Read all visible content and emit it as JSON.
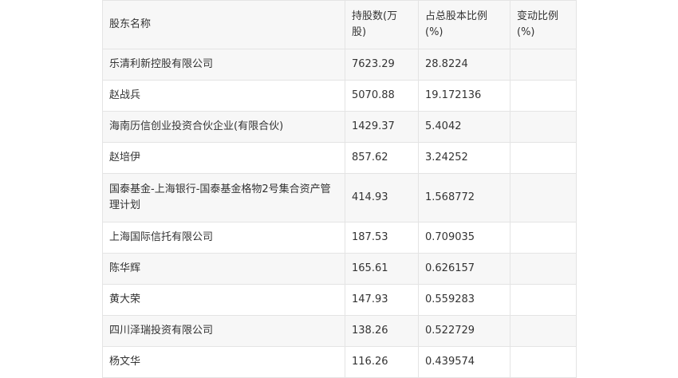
{
  "table": {
    "headers": [
      "股东名称",
      "持股数(万股)",
      "占总股本比例(%)",
      "变动比例(%)"
    ],
    "rows": [
      [
        "乐清利新控股有限公司",
        "7623.29",
        "28.8224",
        ""
      ],
      [
        "赵战兵",
        "5070.88",
        "19.172136",
        ""
      ],
      [
        "海南历信创业投资合伙企业(有限合伙)",
        "1429.37",
        "5.4042",
        ""
      ],
      [
        "赵培伊",
        "857.62",
        "3.24252",
        ""
      ],
      [
        "国泰基金-上海银行-国泰基金格物2号集合资产管理计划",
        "414.93",
        "1.568772",
        ""
      ],
      [
        "上海国际信托有限公司",
        "187.53",
        "0.709035",
        ""
      ],
      [
        "陈华辉",
        "165.61",
        "0.626157",
        ""
      ],
      [
        "黄大荣",
        "147.93",
        "0.559283",
        ""
      ],
      [
        "四川泽瑞投资有限公司",
        "138.26",
        "0.522729",
        ""
      ],
      [
        "杨文华",
        "116.26",
        "0.439574",
        ""
      ]
    ]
  }
}
